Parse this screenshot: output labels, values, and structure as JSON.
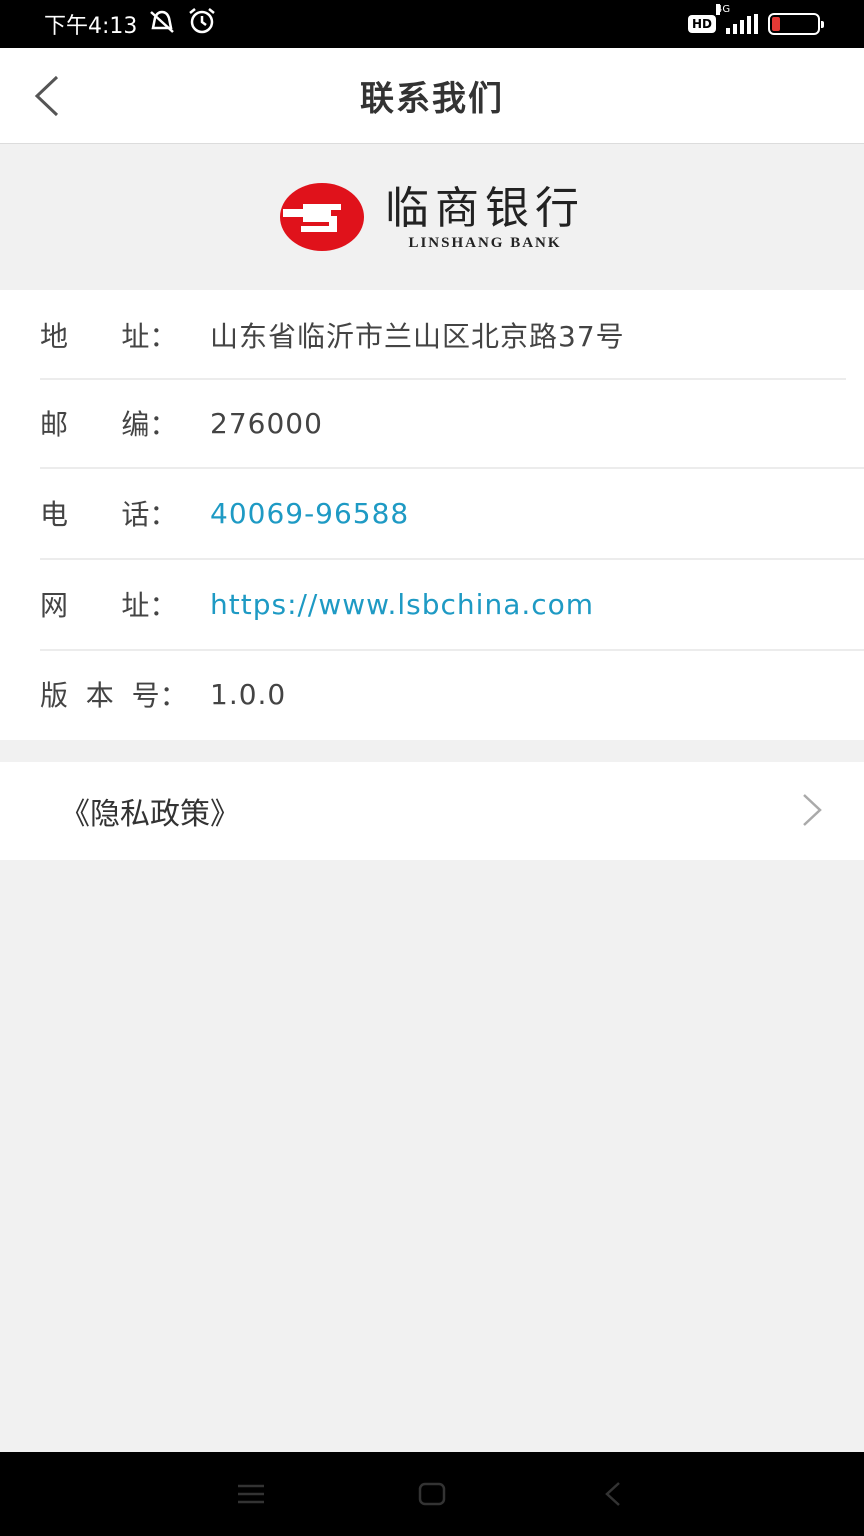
{
  "status_bar": {
    "time": "下午4:13",
    "hd": "HD",
    "network": "4G"
  },
  "nav": {
    "title": "联系我们",
    "back_icon": "chevron-left-icon"
  },
  "logo": {
    "cn_name": "临商银行",
    "en_name": "LINSHANG BANK",
    "brand_color": "#e0121b"
  },
  "contact": {
    "rows": [
      {
        "label": "地      址：",
        "value": "山东省临沂市兰山区北京路37号"
      },
      {
        "label": "邮      编：",
        "value": "276000"
      },
      {
        "label": "电      话：",
        "value": "40069-96588"
      },
      {
        "label": "网      址：",
        "value": "https://www.lsbchina.com"
      },
      {
        "label": "版  本  号：",
        "value": "1.0.0"
      }
    ]
  },
  "privacy": {
    "label": "《隐私政策》"
  },
  "colors": {
    "link": "#1e9ac4",
    "background": "#f1f1f1"
  }
}
